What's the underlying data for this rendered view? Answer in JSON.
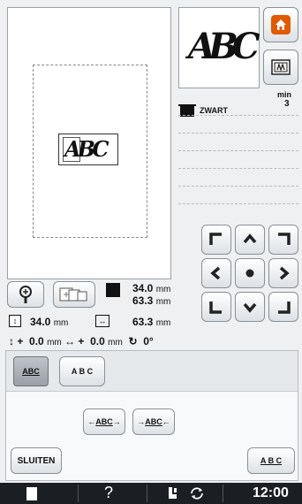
{
  "preview": {
    "pattern_text": "ABC"
  },
  "thumbnail": {
    "text": "ABC"
  },
  "color_list": {
    "min_label": "min",
    "min_value": "3",
    "items": [
      {
        "name": "ZWART",
        "color": "#111111"
      }
    ]
  },
  "size": {
    "width": "34.0",
    "height": "63.3",
    "unit": "mm"
  },
  "row2": {
    "a_value": "34.0",
    "a_unit": "mm",
    "b_value": "63.3",
    "b_unit": "mm"
  },
  "row3": {
    "v_prefix": "+",
    "v_value": "0.0",
    "v_unit": "mm",
    "h_prefix": "+",
    "h_value": "0.0",
    "h_unit": "mm",
    "rotation": "0°"
  },
  "panel": {
    "mode_a_label": "ABC",
    "mode_b_label": "A B C",
    "dir_a_label": "ABC",
    "dir_b_label": "ABC",
    "close_label": "SLUITEN",
    "abc_label": "A B C"
  },
  "statusbar": {
    "help": "?",
    "clock": "12:00"
  },
  "icons": {
    "home": "home-icon",
    "thread_view": "thread-view-icon",
    "zoom": "zoom-icon",
    "arrows": [
      "arrow-upleft-icon",
      "arrow-up-icon",
      "arrow-upright-icon",
      "arrow-left-icon",
      "center-icon",
      "arrow-right-icon",
      "arrow-downleft-icon",
      "arrow-down-icon",
      "arrow-downright-icon"
    ]
  },
  "colors": {
    "accent": "#e05a00",
    "status_bar": "#1b1f24"
  }
}
